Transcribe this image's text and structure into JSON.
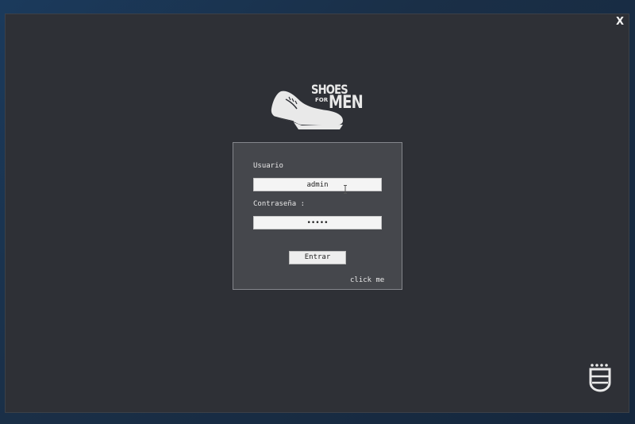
{
  "window": {
    "close_label": "X"
  },
  "logo": {
    "line1": "SHOES",
    "line2": "FOR",
    "line3": "MEN"
  },
  "login": {
    "username_label": "Usuario",
    "username_value": "admin",
    "password_label": "Contraseña :",
    "password_value": "•••••",
    "submit_label": "Entrar",
    "link_label": "click me"
  },
  "icons": {
    "shoe": "shoe-icon",
    "corner": "shield-icon"
  },
  "colors": {
    "window_bg": "#2e3036",
    "panel_bg": "#45474c",
    "desktop_bg": "#1b3a5c"
  }
}
